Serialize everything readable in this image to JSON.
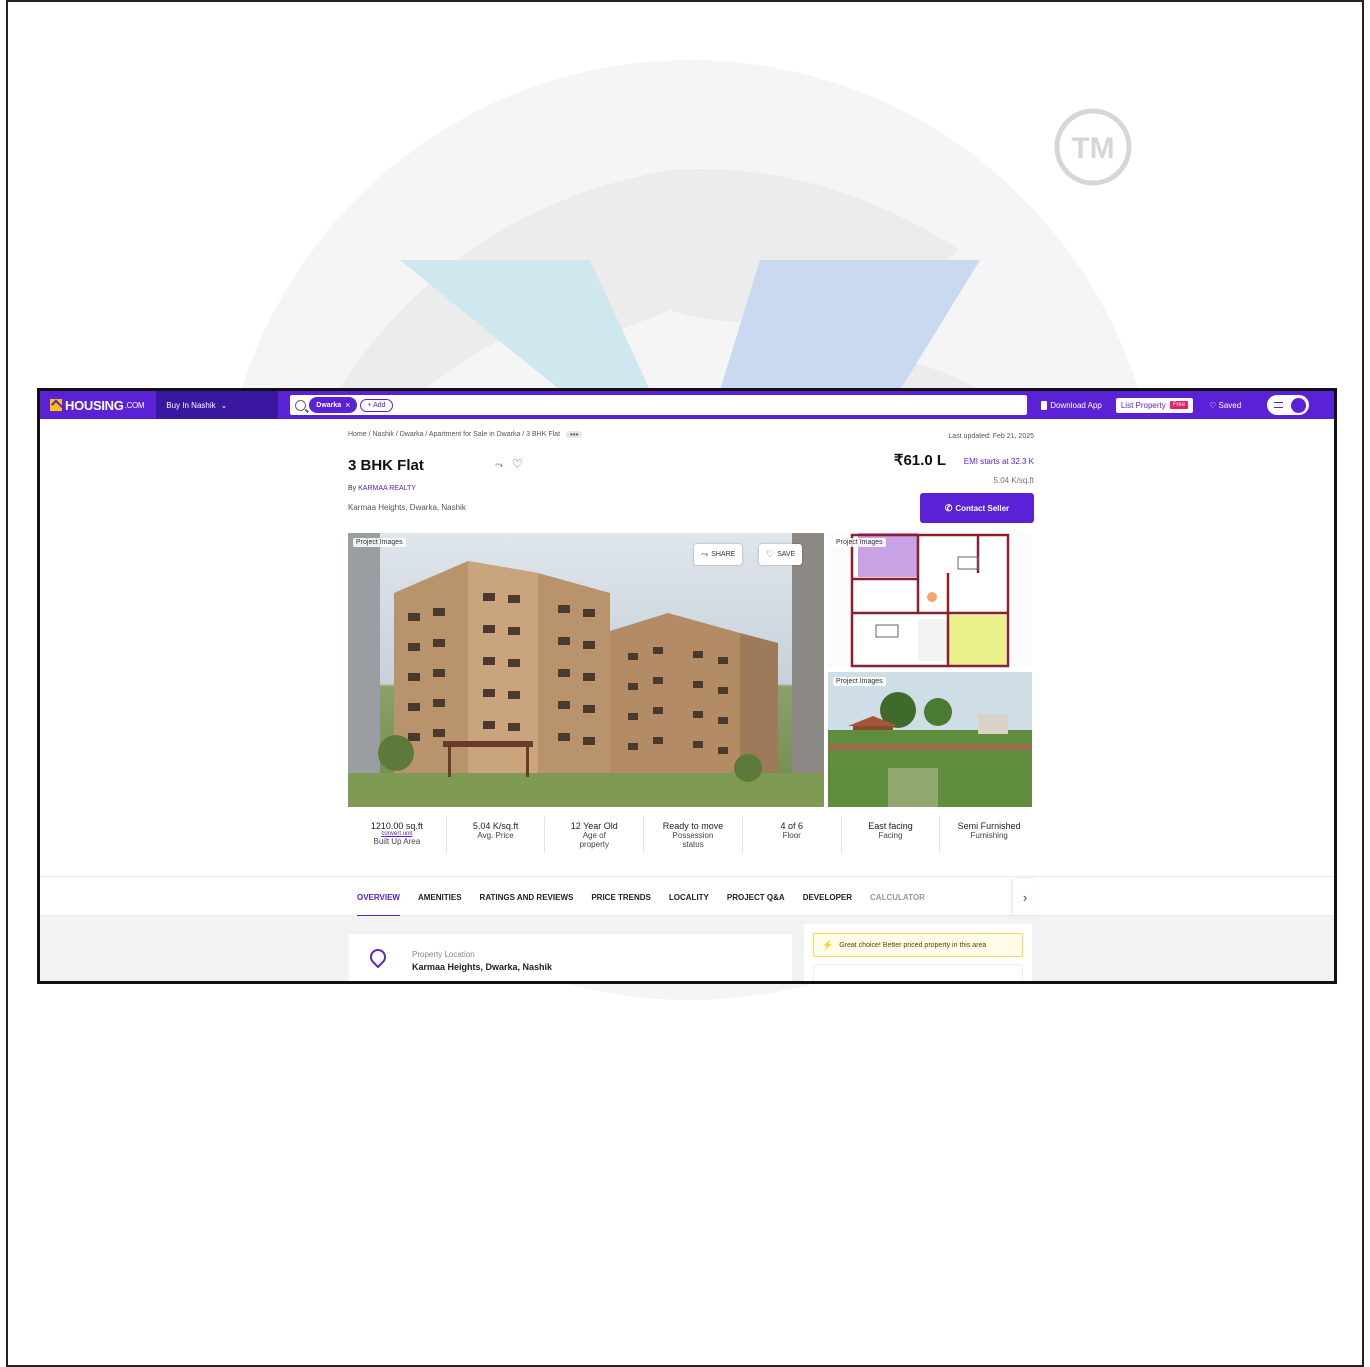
{
  "header": {
    "logo_text": "HOUSING",
    "logo_suffix": ".COM",
    "buy_in": "Buy In Nashik",
    "search_chip": "Dwarka",
    "add_label": "+ Add",
    "download_app": "Download App",
    "list_property": "List Property",
    "free_badge": "Free",
    "saved": "Saved"
  },
  "breadcrumb": "Home / Nashik / Dwarka / Apartment for Sale in Dwarka / 3 BHK Flat",
  "breadcrumb_more": "•••",
  "last_updated": "Last updated: Feb 21, 2025",
  "listing": {
    "title": "3 BHK Flat",
    "by_prefix": "By",
    "developer": "KARMAA REALTY",
    "address": "Karmaa Heights, Dwarka, Nashik",
    "price": "₹61.0 L",
    "emi": "EMI starts at  32.3 K",
    "per_sqft": "5.04 K/sq.ft",
    "contact_button": "Contact Seller"
  },
  "gallery": {
    "main_tag": "Project Images",
    "share_label": "SHARE",
    "save_label": "SAVE",
    "side1_tag": "Project Images",
    "side2_tag": "Project Images"
  },
  "specs": [
    {
      "value": "1210.00 sq.ft",
      "sub": "convert unit",
      "label": "Built Up Area"
    },
    {
      "value": "5.04 K/sq.ft",
      "label": "Avg. Price"
    },
    {
      "value": "12 Year Old",
      "label": "Age of property"
    },
    {
      "value": "Ready to move",
      "label": "Possession status"
    },
    {
      "value": "4 of 6",
      "label": "Floor"
    },
    {
      "value": "East facing",
      "label": "Facing"
    },
    {
      "value": "Semi Furnished",
      "label": "Furnishing"
    }
  ],
  "tabs": [
    "OVERVIEW",
    "AMENITIES",
    "RATINGS AND REVIEWS",
    "PRICE TRENDS",
    "LOCALITY",
    "PROJECT Q&A",
    "DEVELOPER",
    "CALCULATOR"
  ],
  "location": {
    "label": "Property Location",
    "value": "Karmaa Heights, Dwarka, Nashik"
  },
  "choice_banner": "Great choice! Better priced property in this area",
  "colors": {
    "brand": "#5b21d6",
    "accent": "#e91e63",
    "banner": "#fffde7"
  },
  "watermark_mark": "TM"
}
